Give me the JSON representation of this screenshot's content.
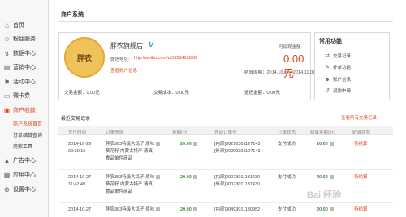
{
  "sidebar": {
    "items": [
      {
        "label": "首页",
        "icon": "home-icon",
        "glyph": "⌂"
      },
      {
        "label": "粉丝服务",
        "icon": "user-icon",
        "glyph": "☺"
      },
      {
        "label": "数据中心",
        "icon": "chart-icon",
        "glyph": "↯"
      },
      {
        "label": "营销中心",
        "icon": "doc-icon",
        "glyph": "▤"
      },
      {
        "label": "活动中心",
        "icon": "flag-icon",
        "glyph": "⚑"
      },
      {
        "label": "微卡券",
        "icon": "card-icon",
        "glyph": "▭"
      },
      {
        "label": "商户收款",
        "icon": "cash-icon",
        "glyph": "▣"
      },
      {
        "label": "广告中心",
        "icon": "ad-icon",
        "glyph": "▲"
      },
      {
        "label": "应用中心",
        "icon": "apps-icon",
        "glyph": "▦"
      },
      {
        "label": "设置中心",
        "icon": "settings-icon",
        "glyph": "⚙"
      }
    ],
    "sub_items": [
      {
        "label": "商户系统首页"
      },
      {
        "label": "订单结算查询"
      },
      {
        "label": "商家工具"
      }
    ]
  },
  "main": {
    "title": "商户系统"
  },
  "shop": {
    "logo_text": "胖农",
    "name": "胖农旗舰店",
    "verified_glyph": "V",
    "url_label": "微信地址:",
    "url": "http://weibo.com/u/3953412888",
    "edit_link": "查看账户信息",
    "balance_label": "可提现金额",
    "balance_value": "0.00元",
    "period": "结算周期：2014.10.17 - 2014.11.01",
    "stats": {
      "trade_amount": "交易金额：0.00元",
      "trade_cost": "交易成本：0.00元",
      "refund_amount": "退还金额：0.00元"
    }
  },
  "functions": {
    "title": "常用功能",
    "items": [
      {
        "label": "交易记录",
        "icon": "exchange-icon",
        "glyph": "⇄"
      },
      {
        "label": "补单功能",
        "icon": "edit-icon",
        "glyph": "✎"
      },
      {
        "label": "账户信息",
        "icon": "account-icon",
        "glyph": "☻"
      },
      {
        "label": "退款申请",
        "icon": "refund-icon",
        "glyph": "↺"
      }
    ]
  },
  "transactions": {
    "title": "最近交易记录",
    "view_all": "查看所有交易记录",
    "columns": [
      "支付时间",
      "订单信息",
      "金额(元)",
      "外部订单号",
      "订单状态",
      "结算金额(元)",
      "结算状态"
    ],
    "rows": [
      {
        "date": "2014-10-29",
        "time": "00:20:15",
        "info": [
          "胖农363特级大瓜子 原味",
          "葵花籽 内蒙古特产 清真",
          "食品单件商品"
        ],
        "amount": "20.00",
        "external_order": [
          "[内部]30290301127143",
          "[外部]30290301127143"
        ],
        "status": "支付成功",
        "settle_amount": "20.00",
        "settle_status": "待结算"
      },
      {
        "date": "2014-10-27",
        "time": "11:42:49",
        "info": [
          "胖农363特级大瓜子 原味",
          "葵花籽 内蒙古特产 清真",
          "食品单件商品"
        ],
        "amount": "20.00",
        "external_order": [
          "[内部]30073011131430",
          "[外部]30073011131430"
        ],
        "status": "支付成功",
        "settle_amount": "20.00",
        "settle_status": "待结算"
      },
      {
        "date": "2014-10-27",
        "time": "",
        "info": [
          "胖农363特级大瓜子 原味",
          "",
          ""
        ],
        "amount": "20.00",
        "external_order": [
          "[内部]30493011130952",
          ""
        ],
        "status": "支付成功",
        "settle_amount": "20.00",
        "settle_status": "待结算"
      }
    ]
  },
  "watermark": "Bai 经验"
}
